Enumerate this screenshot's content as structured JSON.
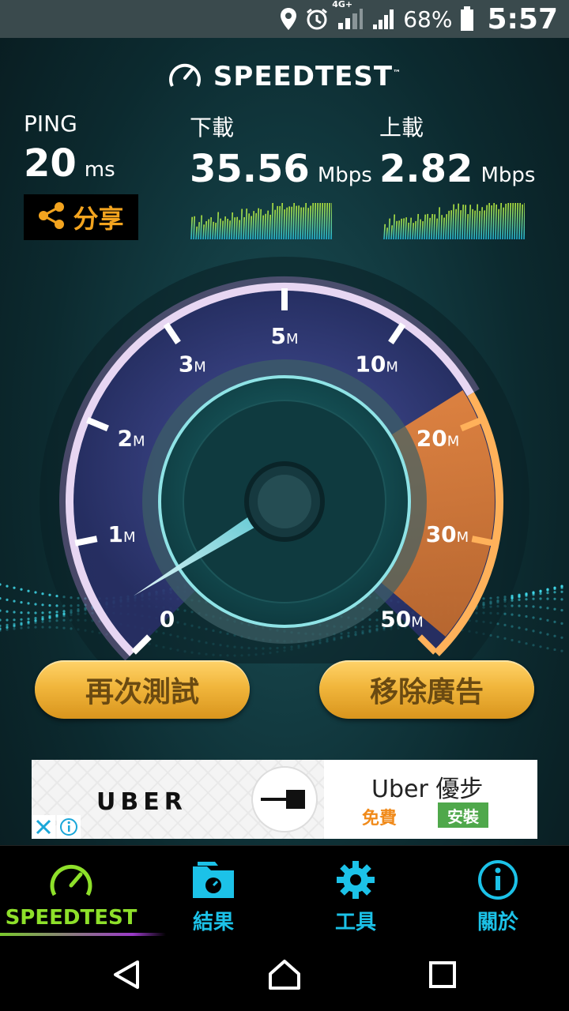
{
  "status_bar": {
    "network_label": "4G+",
    "battery_percent": "68%",
    "time": "5:57",
    "icons": [
      "location-icon",
      "alarm-icon",
      "signal-4g-icon",
      "signal-icon",
      "battery-icon"
    ]
  },
  "header": {
    "title": "SPEEDTEST",
    "trademark": "™"
  },
  "metrics": {
    "ping": {
      "label": "PING",
      "value": "20",
      "unit": "ms"
    },
    "download": {
      "label": "下載",
      "value": "35.56",
      "unit": "Mbps"
    },
    "upload": {
      "label": "上載",
      "value": "2.82",
      "unit": "Mbps"
    }
  },
  "share": {
    "label": "分享"
  },
  "gauge": {
    "ticks": [
      {
        "num": "0",
        "unit": ""
      },
      {
        "num": "1",
        "unit": "M"
      },
      {
        "num": "2",
        "unit": "M"
      },
      {
        "num": "3",
        "unit": "M"
      },
      {
        "num": "5",
        "unit": "M"
      },
      {
        "num": "10",
        "unit": "M"
      },
      {
        "num": "20",
        "unit": "M"
      },
      {
        "num": "30",
        "unit": "M"
      },
      {
        "num": "50",
        "unit": "M"
      }
    ]
  },
  "actions": {
    "retest": "再次測試",
    "remove_ads": "移除廣告"
  },
  "ad": {
    "brand": "UBER",
    "title": "Uber 優步",
    "free": "免費",
    "install": "安裝"
  },
  "nav": {
    "items": [
      {
        "label": "SPEEDTEST",
        "icon": "speedometer-icon",
        "active": true
      },
      {
        "label": "結果",
        "icon": "results-folder-icon",
        "active": false
      },
      {
        "label": "工具",
        "icon": "gear-icon",
        "active": false
      },
      {
        "label": "關於",
        "icon": "info-icon",
        "active": false
      }
    ]
  },
  "colors": {
    "accent_orange": "#f3a41f",
    "accent_teal": "#1cc2e8",
    "accent_green": "#8ee02a",
    "button_gold": "#f1b63c"
  }
}
